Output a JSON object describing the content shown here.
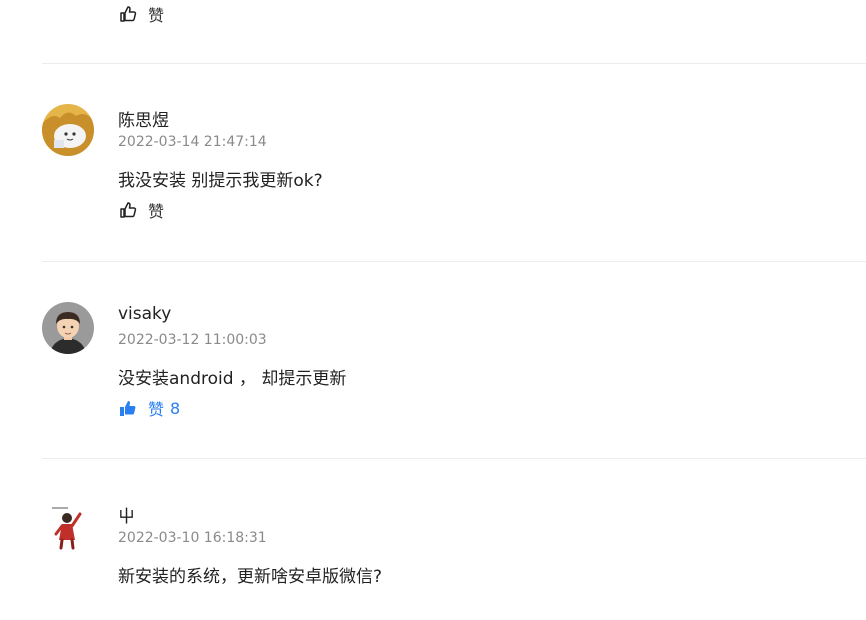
{
  "top_like": {
    "label": "赞"
  },
  "comments": [
    {
      "username": "陈思煜",
      "timestamp": "2022-03-14 21:47:14",
      "content": "我没安装  别提示我更新ok?",
      "like_label": "赞",
      "like_count": "",
      "liked": false,
      "avatar": "cartoon-avatar"
    },
    {
      "username": "visaky",
      "timestamp": "2022-03-12 11:00:03",
      "content": "没安装android ， 却提示更新",
      "like_label": "赞",
      "like_count": "8",
      "liked": true,
      "avatar": "person-avatar"
    },
    {
      "username": "屮",
      "timestamp": "2022-03-10 16:18:31",
      "content": "新安装的系统，更新啥安卓版微信?",
      "like_label": "",
      "like_count": "",
      "liked": false,
      "avatar": "sticker-avatar"
    }
  ],
  "colors": {
    "accent": "#2a7ff0",
    "muted": "#8a8a8a",
    "divider": "#ececec"
  }
}
